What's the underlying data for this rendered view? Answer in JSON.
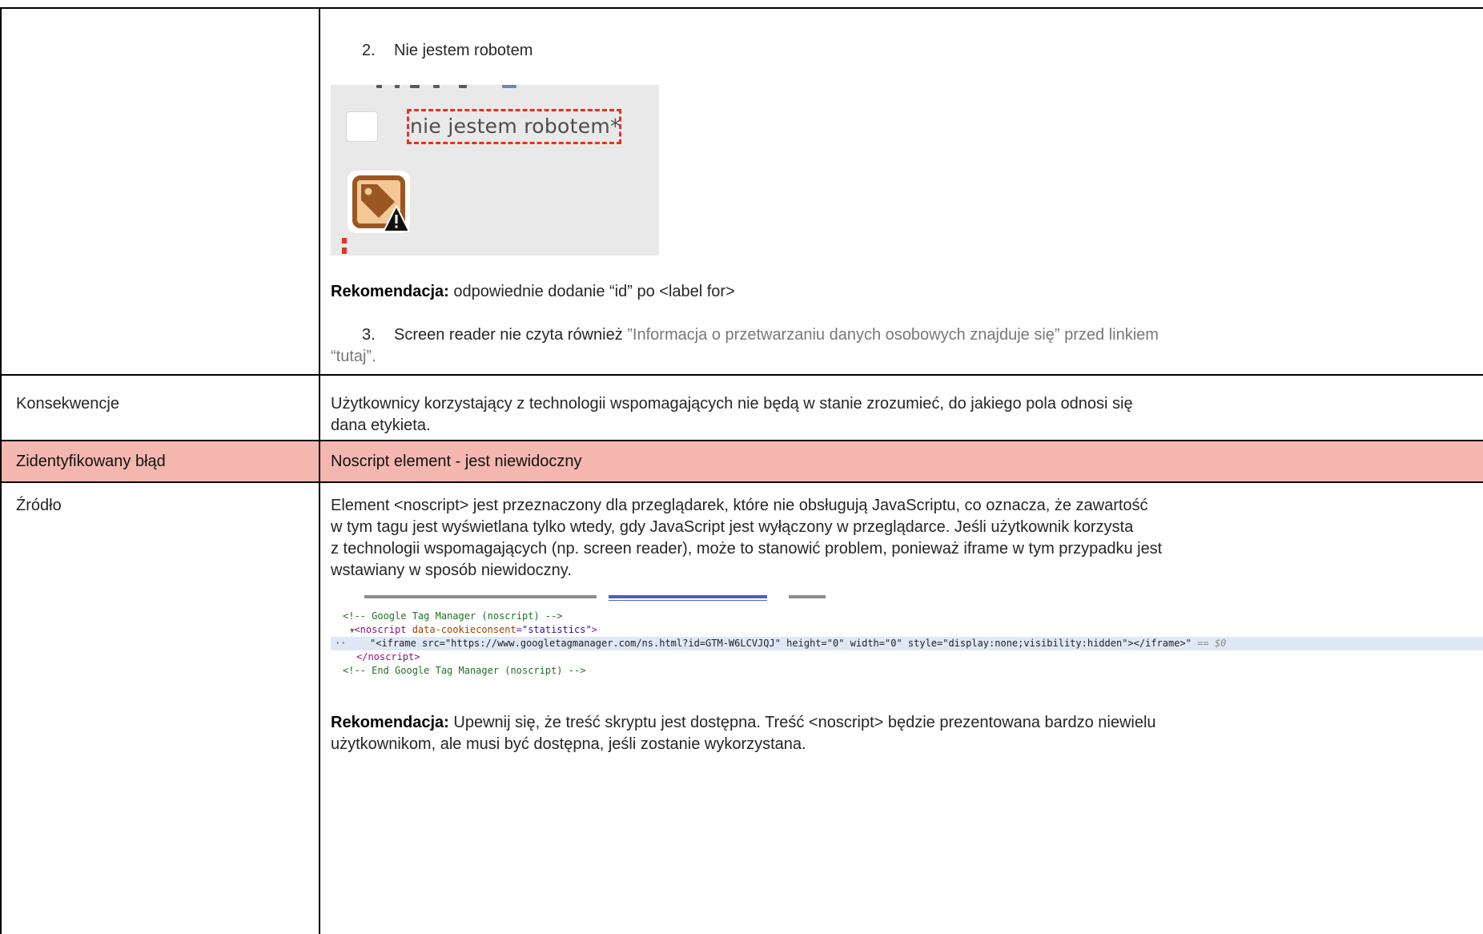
{
  "document": {
    "border_color": "#000000",
    "text_color": "#262626",
    "muted_text_color": "#787878"
  },
  "row_details": {
    "item_2": {
      "number": "2.",
      "text": "Nie jestem robotem"
    },
    "form_screenshot": {
      "checkbox_label": "nie jestem robotem*",
      "icon": "tag-warning-icon",
      "background_color": "#e9e9e9",
      "outline_color": "#e53225"
    },
    "recommendation": {
      "label": "Rekomendacja:",
      "text": "odpowiednie dodanie “id” po <label for>"
    },
    "item_3": {
      "number": "3.",
      "text": "Screen reader nie czyta również",
      "quoted_lines": [
        "”Informacja o przetwarzaniu danych osobowych znajduje się” przed linkiem",
        "“tutaj”."
      ]
    }
  },
  "row_consequences": {
    "label": "Konsekwencje",
    "lines": [
      "Użytkownicy korzystający z technologii wspomagających nie będą w stanie zrozumieć, do jakiego pola odnosi się",
      "dana etykieta."
    ]
  },
  "row_error": {
    "label": "Zidentyfikowany błąd",
    "value": "Noscript element - jest niewidoczny",
    "highlight_color": "#f4b7b0"
  },
  "row_source": {
    "label": "Źródło",
    "lines": [
      "Element <noscript> jest przeznaczony dla przeglądarek, które nie obsługują JavaScriptu, co oznacza, że zawartość",
      "w tym tagu jest wyświetlana tylko wtedy, gdy JavaScript jest wyłączony w przeglądarce. Jeśli użytkownik korzysta",
      "z technologii wspomagających (np. screen reader), może to stanowić problem, ponieważ iframe w tym przypadku jest",
      "wstawiany w sposób niewidoczny."
    ],
    "code_snippet": {
      "comment_open": "<!-- Google Tag Manager (noscript) -->",
      "toggle": "▼",
      "tag_open": "<noscript",
      "attr_name": "data-cookieconsent",
      "equals": "=",
      "attr_value": "\"statistics\"",
      "tag_end": ">",
      "gutter_dots": "··",
      "selected_node": "\"<iframe src=\"https://www.googletagmanager.com/ns.html?id=GTM-W6LCVJQJ\" height=\"0\" width=\"0\" style=\"display:none;visibility:hidden\"></iframe>\"",
      "selected_marker": "== $0",
      "tag_close": "</noscript>",
      "comment_close": "<!-- End Google Tag Manager (noscript) -->",
      "selection_color": "#dfe8f7"
    },
    "recommendation": {
      "label": "Rekomendacja:",
      "lines": [
        "Upewnij się, że treść skryptu jest dostępna. Treść <noscript> będzie prezentowana bardzo niewielu",
        "użytkownikom, ale musi być dostępna, jeśli zostanie wykorzystana."
      ]
    }
  }
}
